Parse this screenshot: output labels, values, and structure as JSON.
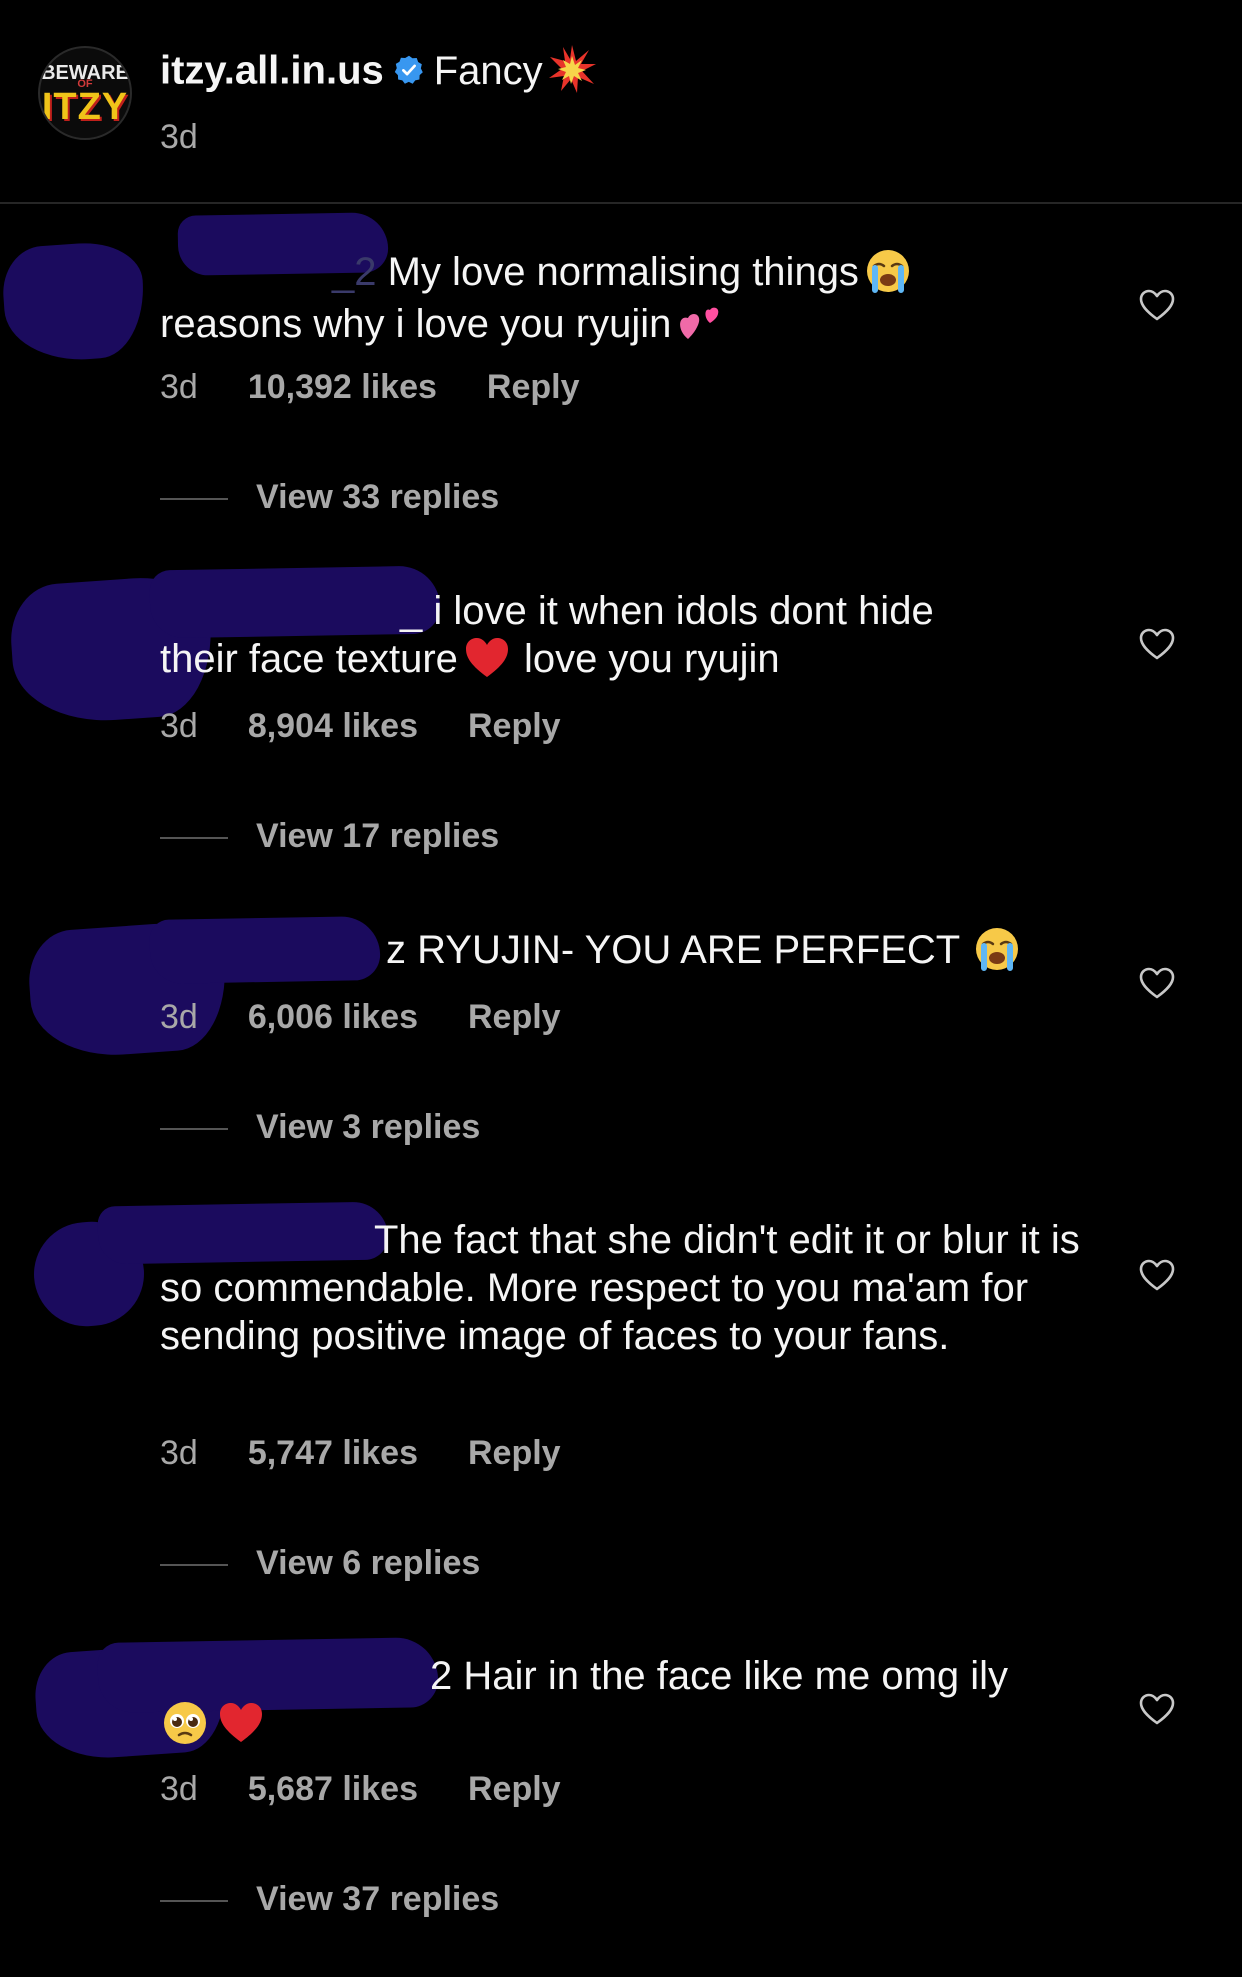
{
  "caption": {
    "username": "itzy.all.in.us",
    "text": "Fancy",
    "time": "3d",
    "avatar": {
      "line1": "BEWARE",
      "line2": "OF",
      "line3": "ITZY"
    }
  },
  "comments": [
    {
      "username_visible": "_2",
      "text_lead": "My love normalising things",
      "text_tail": "reasons why i love you ryujin",
      "time": "3d",
      "likes": "10,392 likes",
      "reply": "Reply",
      "view_replies": "View 33 replies"
    },
    {
      "username_visible": "_",
      "text_lead": "i love it when idols dont hide",
      "text_mid": "their face texture",
      "text_tail": "love you ryujin",
      "time": "3d",
      "likes": "8,904 likes",
      "reply": "Reply",
      "view_replies": "View 17 replies"
    },
    {
      "username_visible": "z",
      "text_lead": "RYUJIN- YOU ARE PERFECT",
      "time": "3d",
      "likes": "6,006 likes",
      "reply": "Reply",
      "view_replies": "View 3 replies"
    },
    {
      "text_lead": "The fact that she didn't edit it or blur it is so commendable. More respect to you ma'am for sending positive image of faces to your fans.",
      "time": "3d",
      "likes": "5,747 likes",
      "reply": "Reply",
      "view_replies": "View 6 replies"
    },
    {
      "username_visible": "2",
      "text_lead": "Hair in the face like me omg ily",
      "time": "3d",
      "likes": "5,687 likes",
      "reply": "Reply",
      "view_replies": "View 37 replies"
    }
  ],
  "icons": {
    "verified": "verified-badge-icon",
    "heart": "heart-outline-icon",
    "emoji_crying": "loudly-crying-face-icon",
    "emoji_two_hearts": "two-hearts-icon",
    "emoji_red_heart": "red-heart-icon",
    "emoji_pleading": "pleading-face-icon",
    "emoji_collision": "collision-icon"
  },
  "colors": {
    "background": "#000000",
    "text": "#f5f5f5",
    "secondary": "#a8a8a8",
    "verified": "#3897f0",
    "redaction": "#1b0b5e"
  }
}
